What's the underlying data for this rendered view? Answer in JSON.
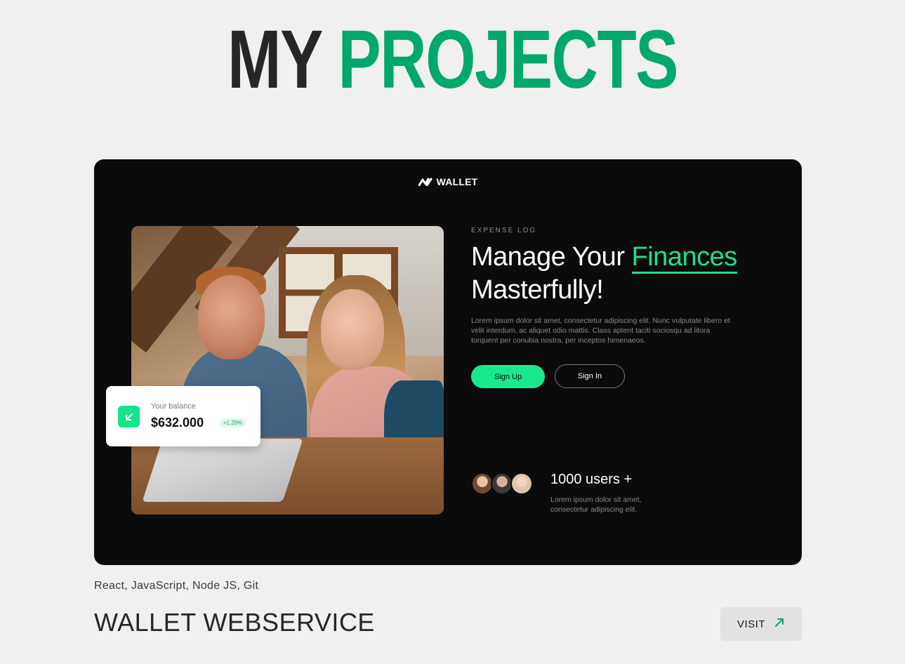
{
  "heading": {
    "word_1": "MY",
    "word_2": "PROJECTS"
  },
  "colors": {
    "accent": "#00a86b",
    "mockup_accent": "#1ae88e",
    "card_bg": "#0b0b0b",
    "page_bg": "#f0f0f0"
  },
  "project": {
    "mockup": {
      "brand": "WALLET",
      "brand_icon": "wallet-logo-icon",
      "eyebrow": "EXPENSE LOG",
      "title_part_1": "Manage Your ",
      "title_accent": "Finances",
      "title_part_2": "Masterfully!",
      "description": "Lorem ipsum dolor sit amet, consectetur adipiscing elit. Nunc vulputate libero et velit interdum, ac aliquet odio mattis. Class aptent taciti sociosqu ad litora torquent per conubia nostra, per inceptos himenaeos.",
      "signup_label": "Sign Up",
      "signin_label": "Sign In",
      "balance": {
        "label": "Your balance",
        "amount": "$632.000",
        "change": "+1.29%",
        "icon": "arrow-down-left-icon"
      },
      "users_count": "1000 users +",
      "users_desc": "Lorem ipsum dolor sit amet, consectetur adipiscing elit."
    },
    "tech_stack": "React, JavaScript, Node JS, Git",
    "title": "WALLET WEBSERVICE",
    "visit_label": "VISIT",
    "visit_icon": "arrow-up-right-icon"
  }
}
